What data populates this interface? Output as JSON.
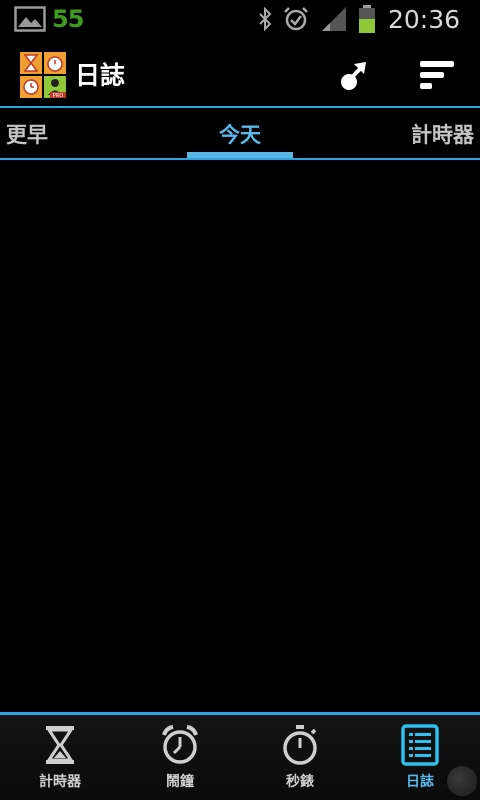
{
  "status_bar": {
    "battery_percent": "55",
    "time": "20:36",
    "icons": [
      "image-icon",
      "bluetooth-icon",
      "alarm-clock-icon",
      "signal-icon",
      "battery-icon"
    ]
  },
  "action_bar": {
    "title": "日誌",
    "icons": [
      "app-logo-icon",
      "share-icon",
      "sort-icon"
    ]
  },
  "tabs": {
    "items": [
      {
        "label": "更早",
        "active": false
      },
      {
        "label": "今天",
        "active": true
      },
      {
        "label": "計時器",
        "active": false
      }
    ]
  },
  "bottom_nav": {
    "items": [
      {
        "label": "計時器",
        "icon": "hourglass-icon",
        "active": false
      },
      {
        "label": "鬧鐘",
        "icon": "alarm-clock-icon",
        "active": false
      },
      {
        "label": "秒錶",
        "icon": "stopwatch-icon",
        "active": false
      },
      {
        "label": "日誌",
        "icon": "log-list-icon",
        "active": true
      }
    ]
  },
  "colors": {
    "accent": "#5ab7e8",
    "divider": "#2fa4de",
    "battery_text": "#3d9b1f",
    "background": "#000000"
  }
}
